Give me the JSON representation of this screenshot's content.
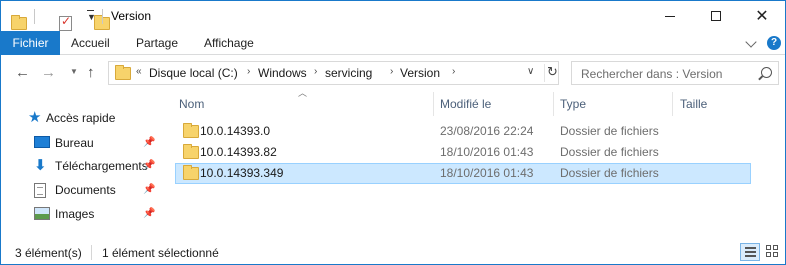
{
  "window": {
    "title": "Version",
    "icons": [
      "folder-icon",
      "properties-icon",
      "new-folder-icon",
      "customize-toolbar-icon"
    ]
  },
  "ribbon": {
    "tabs": [
      {
        "label": "Fichier",
        "active": true
      },
      {
        "label": "Accueil"
      },
      {
        "label": "Partage"
      },
      {
        "label": "Affichage"
      }
    ],
    "help_symbol": "?"
  },
  "address": {
    "overflow": "«",
    "segments": [
      "Disque local (C:)",
      "Windows",
      "servicing",
      "Version"
    ],
    "separator": "›"
  },
  "search": {
    "placeholder": "Rechercher dans : Version"
  },
  "sidebar": {
    "quick_access": "Accès rapide",
    "items": [
      {
        "label": "Bureau",
        "icon": "desktop-icon",
        "pinned": true
      },
      {
        "label": "Téléchargements",
        "icon": "download-icon",
        "pinned": true
      },
      {
        "label": "Documents",
        "icon": "documents-icon",
        "pinned": true
      },
      {
        "label": "Images",
        "icon": "pictures-icon",
        "pinned": true
      }
    ]
  },
  "columns": [
    "Nom",
    "Modifié le",
    "Type",
    "Taille"
  ],
  "files": [
    {
      "name": "10.0.14393.0",
      "modified": "23/08/2016 22:24",
      "type": "Dossier de fichiers",
      "size": "",
      "selected": false
    },
    {
      "name": "10.0.14393.82",
      "modified": "18/10/2016 01:43",
      "type": "Dossier de fichiers",
      "size": "",
      "selected": false
    },
    {
      "name": "10.0.14393.349",
      "modified": "18/10/2016 01:43",
      "type": "Dossier de fichiers",
      "size": "",
      "selected": true
    }
  ],
  "status": {
    "count": "3 élément(s)",
    "selection": "1 élément sélectionné"
  },
  "colors": {
    "accent": "#1979ca",
    "selection_bg": "#cce8ff",
    "selection_border": "#99d1ff",
    "folder": "#f7d36b"
  }
}
